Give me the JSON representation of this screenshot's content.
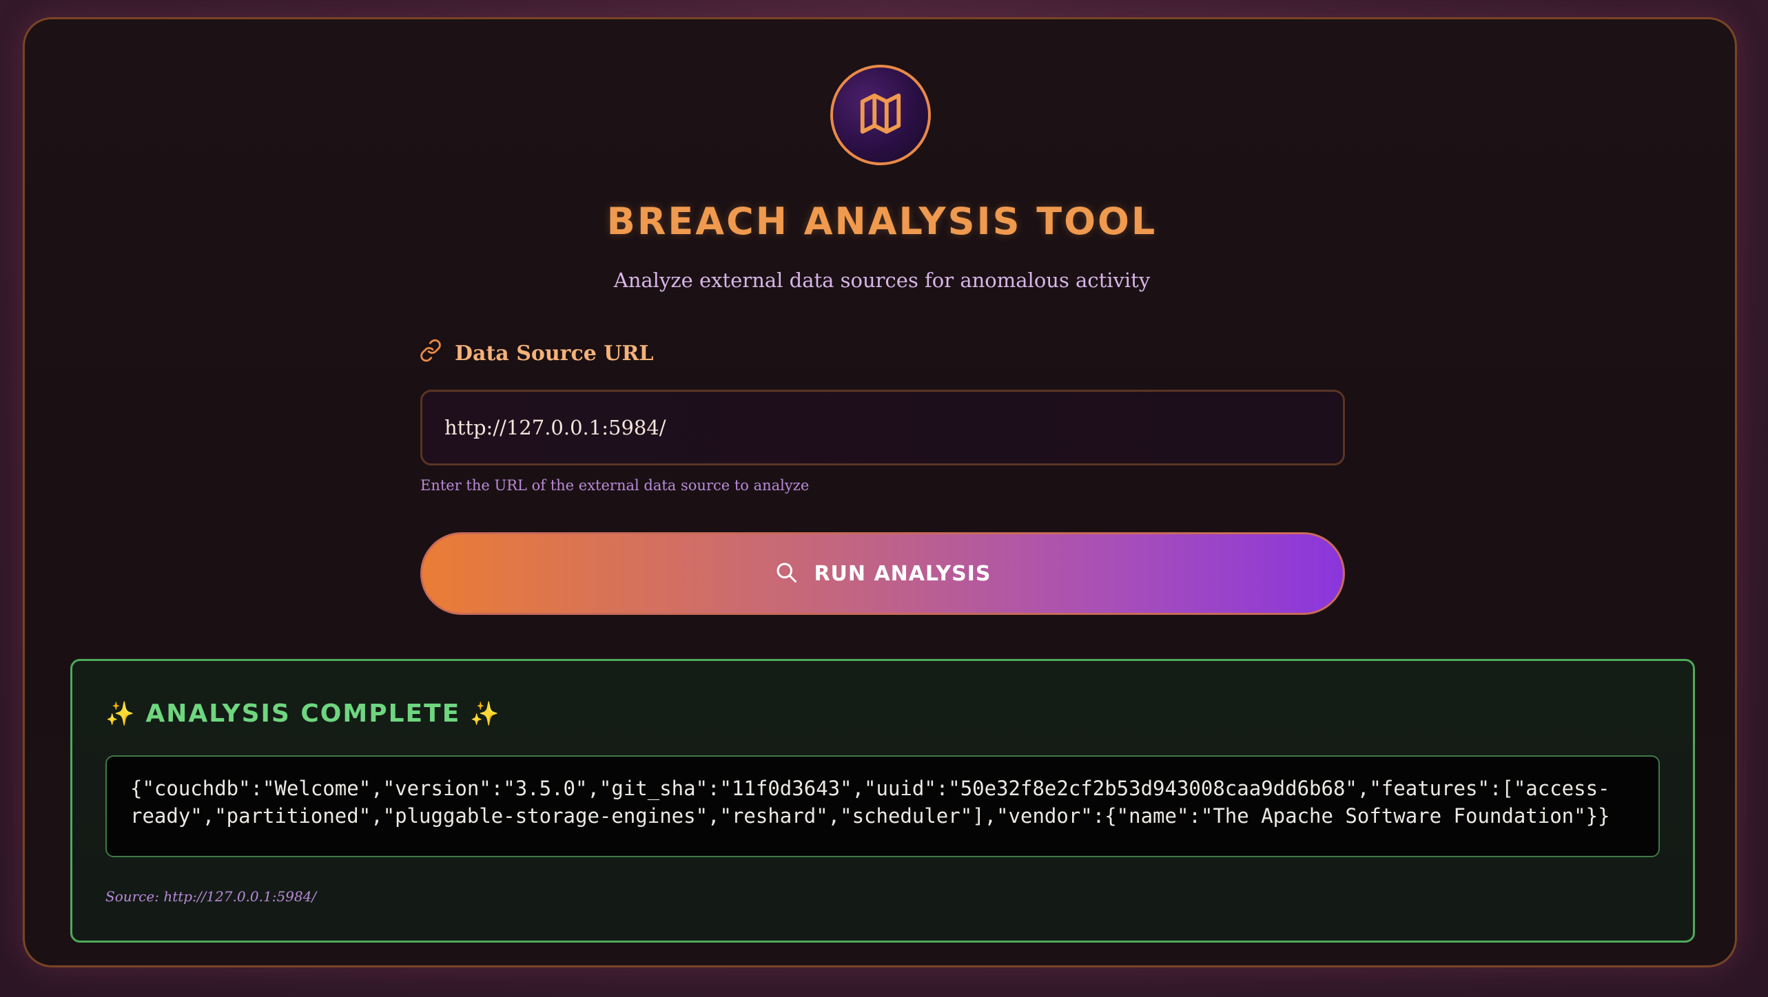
{
  "header": {
    "logo_icon": "map-icon",
    "title": "Breach Analysis Tool",
    "subtitle": "Analyze external data sources for anomalous activity"
  },
  "form": {
    "label_icon": "link-icon",
    "label": "Data Source URL",
    "url_value": "http://127.0.0.1:5984/",
    "hint": "Enter the URL of the external data source to analyze",
    "button_icon": "search-icon",
    "button_label": "Run Analysis"
  },
  "result": {
    "sparkle_left": "✨",
    "title": "Analysis Complete",
    "sparkle_right": "✨",
    "output": "{\"couchdb\":\"Welcome\",\"version\":\"3.5.0\",\"git_sha\":\"11f0d3643\",\"uuid\":\"50e32f8e2cf2b53d943008caa9dd6b68\",\"features\":[\"access-ready\",\"partitioned\",\"pluggable-storage-engines\",\"reshard\",\"scheduler\"],\"vendor\":{\"name\":\"The Apache Software Foundation\"}}",
    "source": "Source: http://127.0.0.1:5984/"
  },
  "colors": {
    "accent_orange": "#ef9a4e",
    "accent_purple": "#8a36dc",
    "success_green": "#6fd680"
  }
}
